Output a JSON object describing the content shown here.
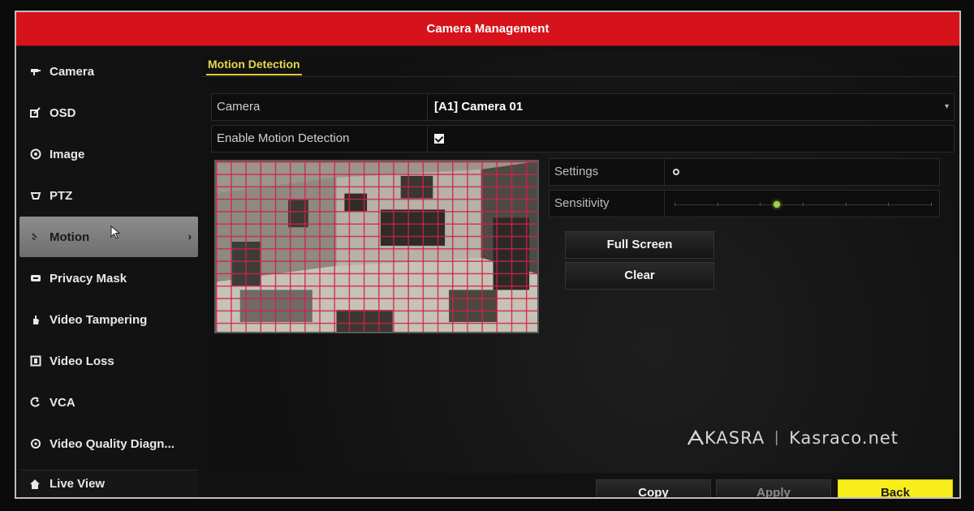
{
  "window": {
    "title": "Camera Management"
  },
  "sidebar": {
    "items": [
      {
        "label": "Camera",
        "icon": "camera-icon"
      },
      {
        "label": "OSD",
        "icon": "osd-icon"
      },
      {
        "label": "Image",
        "icon": "image-icon"
      },
      {
        "label": "PTZ",
        "icon": "ptz-icon"
      },
      {
        "label": "Motion",
        "icon": "motion-icon",
        "active": true
      },
      {
        "label": "Privacy Mask",
        "icon": "privacy-mask-icon"
      },
      {
        "label": "Video Tampering",
        "icon": "video-tampering-icon"
      },
      {
        "label": "Video Loss",
        "icon": "video-loss-icon"
      },
      {
        "label": "VCA",
        "icon": "vca-icon"
      },
      {
        "label": "Video Quality Diagn...",
        "icon": "video-quality-icon"
      }
    ],
    "live_view": {
      "label": "Live View",
      "icon": "home-icon"
    }
  },
  "main": {
    "tab": "Motion Detection",
    "camera": {
      "label": "Camera",
      "value": "[A1] Camera 01"
    },
    "enable": {
      "label": "Enable Motion Detection",
      "checked": true
    },
    "settings": {
      "label": "Settings"
    },
    "sensitivity": {
      "label": "Sensitivity",
      "level": 0.4,
      "ticks": 7
    },
    "buttons": {
      "full_screen": "Full Screen",
      "clear": "Clear"
    }
  },
  "footer": {
    "copy": "Copy",
    "apply": "Apply",
    "back": "Back"
  },
  "watermark": {
    "brand": "KASRA",
    "site": "Kasraco.net"
  },
  "colors": {
    "title_bar": "#d6121a",
    "tab_accent": "#e4d94f",
    "back_button": "#f7ee1c",
    "grid": "#d61e48"
  }
}
